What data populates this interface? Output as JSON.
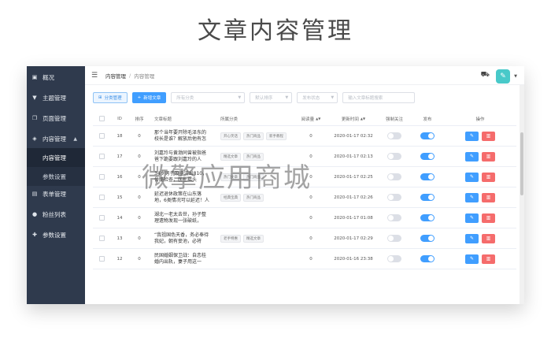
{
  "page_title": "文章内容管理",
  "watermark": "微擎应用商城",
  "sidebar": {
    "items": [
      {
        "label": "概况",
        "icon": "dashboard-icon"
      },
      {
        "label": "主题管理",
        "icon": "shirt-icon"
      },
      {
        "label": "页面管理",
        "icon": "pages-icon"
      },
      {
        "label": "内容管理",
        "icon": "layers-icon"
      },
      {
        "label": "内容管理",
        "sub": true,
        "active": true
      },
      {
        "label": "参数设置",
        "sub": true
      },
      {
        "label": "表单管理",
        "icon": "form-icon"
      },
      {
        "label": "粉丝列表",
        "icon": "user-icon"
      },
      {
        "label": "参数设置",
        "icon": "settings-icon"
      }
    ]
  },
  "topbar": {
    "breadcrumb_1": "内容管理",
    "breadcrumb_sep": "/",
    "breadcrumb_2": "内容管理"
  },
  "toolbar": {
    "category_btn": "分类管理",
    "add_btn": "新增文章",
    "filter_category_placeholder": "所有分类",
    "filter_sort_placeholder": "默认排序",
    "filter_status_placeholder": "发布状态",
    "search_placeholder": "输入文章标题搜索"
  },
  "table": {
    "headers": {
      "id": "ID",
      "sort": "排序",
      "title": "文章标题",
      "category": "所属分类",
      "read": "阅读量",
      "time": "更新时间",
      "recommend": "强制关注",
      "publish": "发布",
      "ops": "操作"
    },
    "rows": [
      {
        "id": "18",
        "sort": "0",
        "title": "那个当年要开除毛泽东的校长是谁？解放后他有怎",
        "tags": [
          "开心笑话",
          "热门商品",
          "新手教程"
        ],
        "read": "0",
        "time": "2020-01-17 02:32",
        "recommend": false,
        "publish": true
      },
      {
        "id": "17",
        "sort": "0",
        "title": "刘嘉玲与黄渤同曾被指爸爸下跪要跟刘嘉玲的人",
        "tags": [
          "精选文章",
          "热门商品"
        ],
        "read": "0",
        "time": "2020-01-17 02:13",
        "recommend": false,
        "publish": true
      },
      {
        "id": "16",
        "sort": "0",
        "title": "34岁男子吸脂流出810，骨髓检查，医生摇头",
        "tags": [
          "热门文章",
          "热门商品"
        ],
        "read": "0",
        "time": "2020-01-17 02:25",
        "recommend": false,
        "publish": true
      },
      {
        "id": "15",
        "sort": "0",
        "title": "延迟退休政策在山东落地，6类情况可以延迟！人",
        "tags": [
          "经典宝典",
          "热门商品"
        ],
        "read": "0",
        "time": "2020-01-17 02:26",
        "recommend": false,
        "publish": true
      },
      {
        "id": "14",
        "sort": "0",
        "title": "湖北一老太去世，孙子整理遗物发现一张破纸，",
        "tags": [],
        "read": "0",
        "time": "2020-01-17 01:08",
        "recommend": false,
        "publish": true
      },
      {
        "id": "13",
        "sort": "0",
        "title": "“我祖国色天香，务必奉待我妃，朝有妾池，必将",
        "tags": [
          "老手特惠",
          "精选文章"
        ],
        "read": "0",
        "time": "2020-01-17 02:29",
        "recommend": false,
        "publish": true
      },
      {
        "id": "12",
        "sort": "0",
        "title": "民国婚姻保卫战：自恋桂婚内出轨，妻子用这一",
        "tags": [],
        "read": "0",
        "time": "2020-01-16 23:38",
        "recommend": false,
        "publish": true
      }
    ]
  }
}
